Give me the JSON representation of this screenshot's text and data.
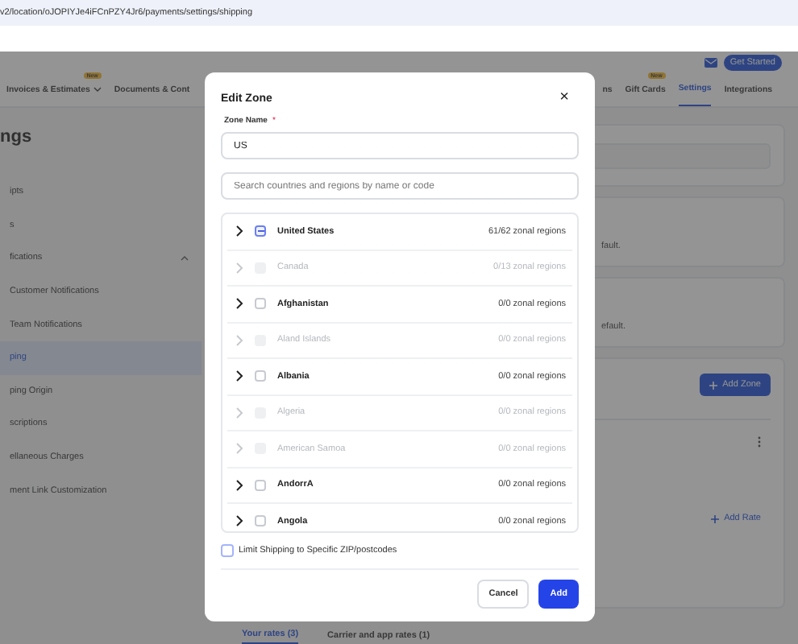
{
  "address_bar": {
    "url": "v2/location/oJOPIYJe4iFCnPZY4Jr6/payments/settings/shipping"
  },
  "header": {
    "get_started": "Get Started"
  },
  "nav_tabs": [
    {
      "label": "Invoices & Estimates",
      "badge": "New",
      "caret": true,
      "selected": false
    },
    {
      "label": "Documents & Cont",
      "selected": false
    },
    {
      "label": "ns",
      "selected": false
    },
    {
      "label": "Gift Cards",
      "badge": "New",
      "selected": false
    },
    {
      "label": "Settings",
      "selected": true
    },
    {
      "label": "Integrations",
      "selected": false
    }
  ],
  "sidebar": {
    "heading": "ngs",
    "items": [
      {
        "label": "ipts",
        "selected": false
      },
      {
        "label": "s",
        "selected": false
      },
      {
        "label": "fications",
        "selected": false,
        "expanded": true
      },
      {
        "label": "Customer Notifications",
        "selected": false
      },
      {
        "label": "Team Notifications",
        "selected": false
      },
      {
        "label": "ping",
        "selected": true
      },
      {
        "label": "ping Origin",
        "selected": false
      },
      {
        "label": "scriptions",
        "selected": false
      },
      {
        "label": "ellaneous Charges",
        "selected": false
      },
      {
        "label": "ment Link Customization",
        "selected": false
      }
    ]
  },
  "main": {
    "card_texts": [
      "fault.",
      "efault."
    ],
    "add_zone": "Add Zone",
    "add_rate": "Add Rate",
    "rate_tabs": [
      {
        "label": "Your rates (3)",
        "selected": true
      },
      {
        "label": "Carrier and app rates (1)",
        "selected": false
      }
    ]
  },
  "modal": {
    "title": "Edit Zone",
    "close": "×",
    "zone_name_label": "Zone Name",
    "required_mark": "*",
    "zone_name_value": "US",
    "search": {
      "placeholder": "Search countries and regions by name or code"
    },
    "regions": [
      {
        "name": "United States",
        "count": "61/62 zonal regions",
        "disabled": false,
        "checked": false,
        "indeterminate": true
      },
      {
        "name": "Canada",
        "count": "0/13 zonal regions",
        "disabled": true,
        "checked": false,
        "indeterminate": false
      },
      {
        "name": "Afghanistan",
        "count": "0/0 zonal regions",
        "disabled": false,
        "checked": false,
        "indeterminate": false
      },
      {
        "name": "Aland Islands",
        "count": "0/0 zonal regions",
        "disabled": true,
        "checked": false,
        "indeterminate": false
      },
      {
        "name": "Albania",
        "count": "0/0 zonal regions",
        "disabled": false,
        "checked": false,
        "indeterminate": false
      },
      {
        "name": "Algeria",
        "count": "0/0 zonal regions",
        "disabled": true,
        "checked": false,
        "indeterminate": false
      },
      {
        "name": "American Samoa",
        "count": "0/0 zonal regions",
        "disabled": true,
        "checked": false,
        "indeterminate": false
      },
      {
        "name": "AndorrA",
        "count": "0/0 zonal regions",
        "disabled": false,
        "checked": false,
        "indeterminate": false
      },
      {
        "name": "Angola",
        "count": "0/0 zonal regions",
        "disabled": false,
        "checked": false,
        "indeterminate": false
      }
    ],
    "limit_zip": {
      "label": "Limit Shipping to Specific ZIP/postcodes",
      "checked": false
    },
    "buttons": {
      "cancel": "Cancel",
      "add": "Add"
    }
  }
}
